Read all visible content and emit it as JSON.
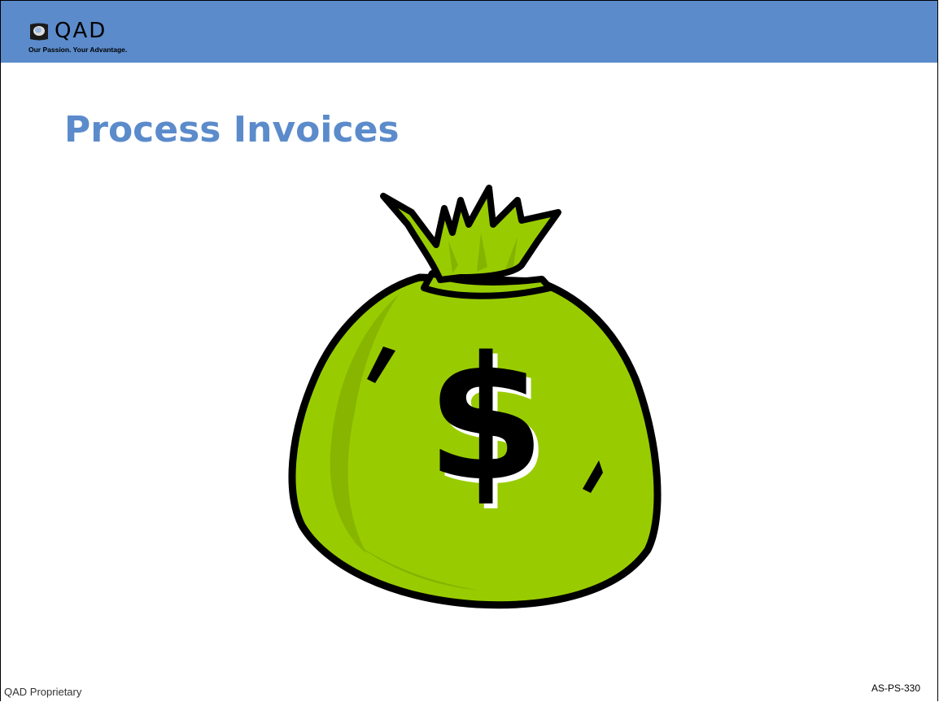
{
  "header": {
    "logo_text": "QAD",
    "tagline": "Our Passion. Your Advantage.",
    "band_color": "#5b8bcb"
  },
  "slide": {
    "title": "Process Invoices",
    "title_color": "#5b8bcb",
    "illustration": "money-bag-dollar-icon",
    "bag_color": "#99cc00"
  },
  "footer": {
    "left_text": "QAD Proprietary",
    "right_text": "AS-PS-330"
  }
}
